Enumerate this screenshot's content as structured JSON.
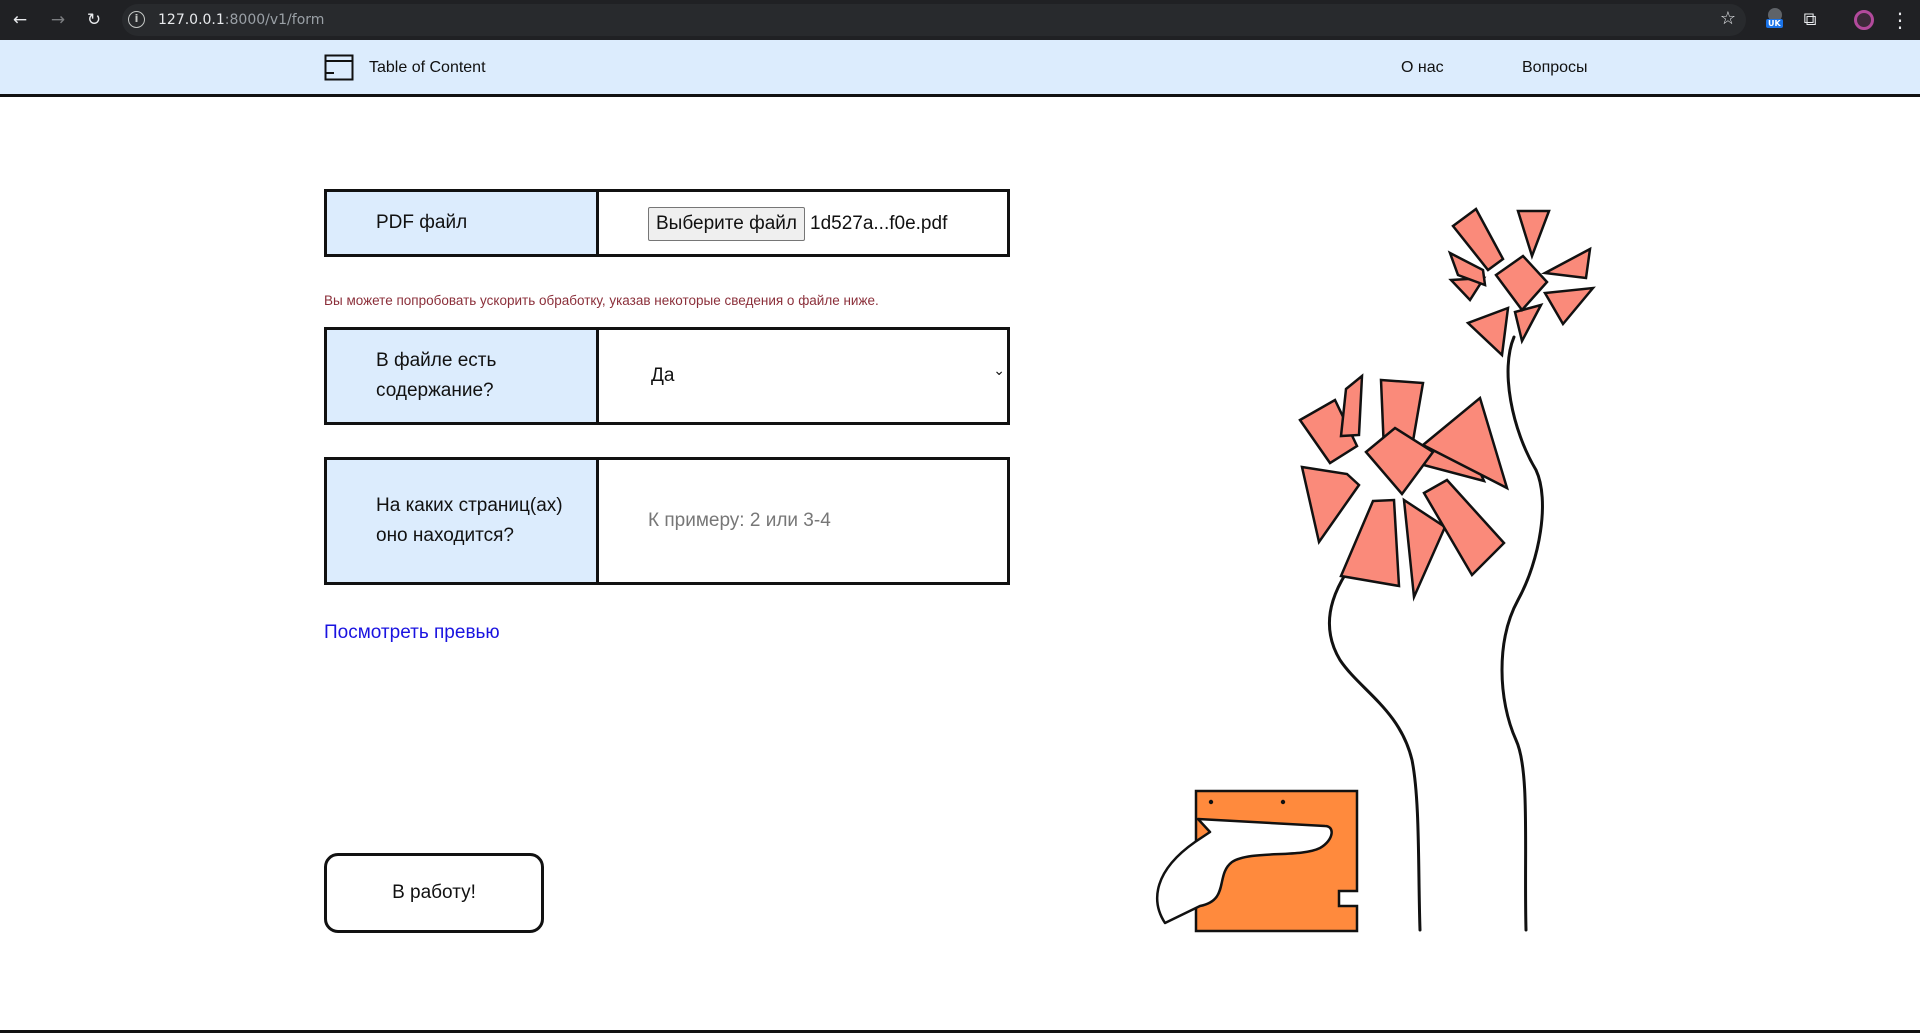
{
  "browser": {
    "url_host": "127.0.0.1",
    "url_path": ":8000/v1/form",
    "extension_badge": "UK"
  },
  "header": {
    "brand": "Table of Content",
    "nav": [
      {
        "label": "О нас"
      },
      {
        "label": "Вопросы"
      }
    ]
  },
  "form": {
    "pdf": {
      "label": "PDF файл",
      "button_label": "Выберите файл",
      "file_name": "1d527a...f0e.pdf"
    },
    "hint": "Вы можете попробовать ускорить обработку, указав некоторые сведения о файле ниже.",
    "has_toc": {
      "label": "В файле есть содержание?",
      "selected": "Да"
    },
    "pages": {
      "label": "На каких страниц(ах) оно находится?",
      "placeholder": "К примеру: 2 или 3-4",
      "value": ""
    },
    "preview_link": "Посмотреть превью",
    "submit_label": "В работу!"
  },
  "colors": {
    "header_bg": "#dcecfd",
    "label_bg": "#dcecfd",
    "hint": "#8b2f3a",
    "link": "#1a13e0",
    "flower": "#fa8a7a",
    "box": "#ff8a3d"
  }
}
